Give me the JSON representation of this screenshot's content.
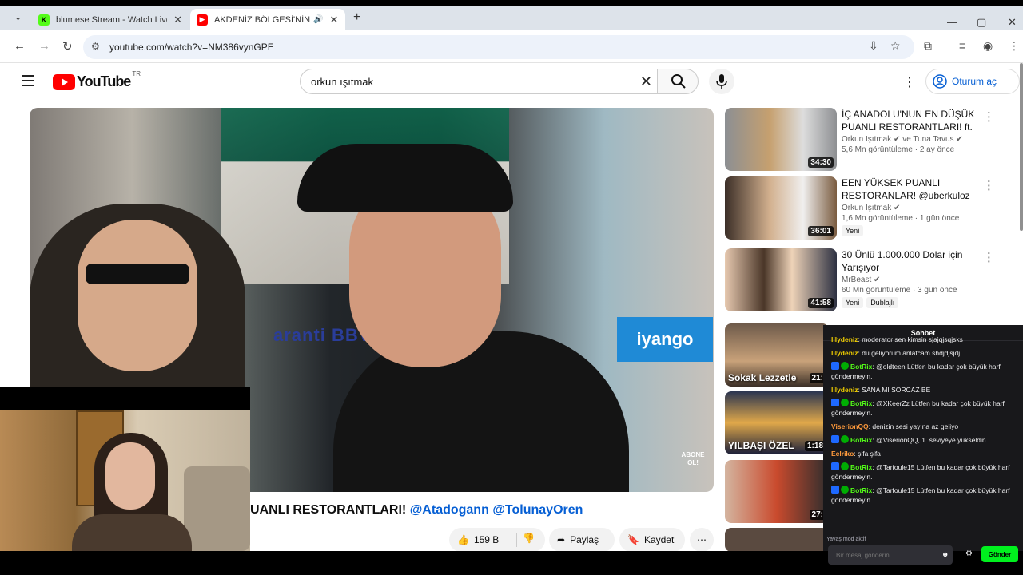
{
  "browser": {
    "tabs": [
      {
        "title": "blumese Stream - Watch Live on",
        "favicon": "kick-icon",
        "color": "#53fc18"
      },
      {
        "title": "AKDENİZ BÖLGESİ'NİN EN D",
        "favicon": "youtube-icon",
        "color": "#ff0000"
      }
    ],
    "url": "youtube.com/watch?v=NM386vynGPE"
  },
  "youtube": {
    "region": "TR",
    "search_value": "orkun ışıtmak",
    "signin_label": "Oturum aç",
    "video": {
      "title_visible": "UANLI RESTORANTLARI!",
      "mention1": "@Atadogann",
      "mention2": "@TolunayOren",
      "likes": "159 B",
      "share_label": "Paylaş",
      "save_label": "Kaydet",
      "overlay_bank": "aranti BBVA",
      "overlay_sign": "iyango",
      "overlay_subscribe": "ABONE OL!"
    },
    "recommendations": [
      {
        "title": "İÇ ANADOLU'NUN EN DÜŞÜK PUANLI RESTORANTLARI! ft. ...",
        "channel": "Orkun Işıtmak",
        "channel2": "ve Tuna Tavus",
        "meta": "5,6 Mn görüntüleme · 2 ay önce",
        "duration": "34:30",
        "badges": []
      },
      {
        "title": "EEN YÜKSEK PUANLI RESTORANLAR! @uberkuloz ...",
        "channel": "Orkun Işıtmak",
        "channel2": "",
        "meta": "1,6 Mn görüntüleme · 1 gün önce",
        "duration": "36:01",
        "badges": [
          "Yeni"
        ]
      },
      {
        "title": "30 Ünlü 1.000.000 Dolar için Yarışıyor",
        "channel": "MrBeast",
        "channel2": "",
        "meta": "60 Mn görüntüleme · 3 gün önce",
        "duration": "41:58",
        "badges": [
          "Yeni",
          "Dublajlı"
        ]
      }
    ],
    "partial_thumbs": [
      {
        "duration": "21:",
        "caption": "Sokak Lezzetle"
      },
      {
        "duration": "1:18",
        "caption": "YILBAŞI ÖZEL"
      },
      {
        "duration": "27:",
        "caption": ""
      }
    ]
  },
  "chat": {
    "header": "Sohbet",
    "messages": [
      {
        "user": "lilydeniz",
        "color": "#f3d000",
        "text": "moderator sen kimsin sjajqjsqjsks",
        "bot": false
      },
      {
        "user": "lilydeniz",
        "color": "#f3d000",
        "text": "du geliyorum anlatcam shdjdjsjdj",
        "bot": false
      },
      {
        "user": "BotRix",
        "color": "#53fc18",
        "text": "@oldteen Lütfen bu kadar çok büyük harf göndermeyin.",
        "bot": true
      },
      {
        "user": "lilydeniz",
        "color": "#f3d000",
        "text": "SANA MI SORCAZ BE",
        "bot": false
      },
      {
        "user": "BotRix",
        "color": "#53fc18",
        "text": "@XKeerZz Lütfen bu kadar çok büyük harf göndermeyin.",
        "bot": true
      },
      {
        "user": "ViserionQQ",
        "color": "#ff9a3c",
        "text": "denizin sesi yayına az geliyo",
        "bot": false
      },
      {
        "user": "BotRix",
        "color": "#53fc18",
        "text": "@ViserionQQ, 1. seviyeye yükseldin",
        "bot": true
      },
      {
        "user": "Eclriko",
        "color": "#ff9a3c",
        "text": "şifa şifa",
        "bot": false
      },
      {
        "user": "BotRix",
        "color": "#53fc18",
        "text": "@Tarfoule15 Lütfen bu kadar çok büyük harf göndermeyin.",
        "bot": true
      },
      {
        "user": "BotRix",
        "color": "#53fc18",
        "text": "@Tarfoule15 Lütfen bu kadar çok büyük harf göndermeyin.",
        "bot": true
      }
    ],
    "slow_mode": "Yavaş mod aktif",
    "input_placeholder": "Bir mesaj gönderin",
    "send_label": "Gönder"
  }
}
